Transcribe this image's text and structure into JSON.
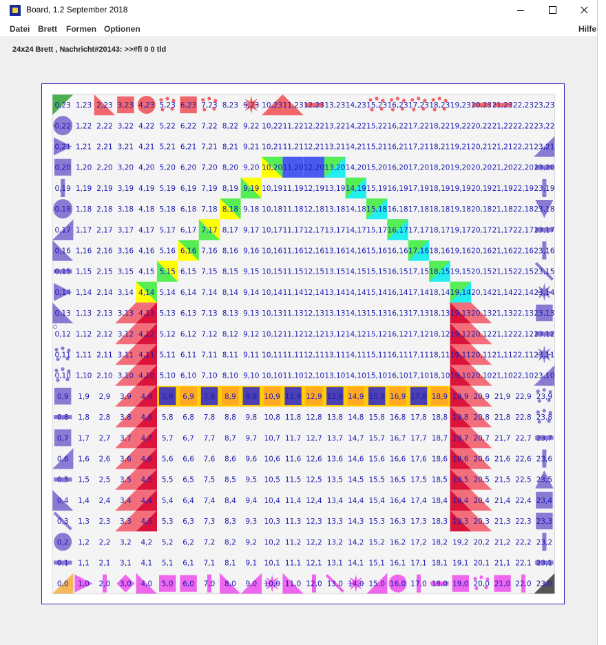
{
  "window": {
    "title": "Board, 1.2 September 2018"
  },
  "menu": {
    "datei": "Datei",
    "brett": "Brett",
    "formen": "Formen",
    "optionen": "Optionen",
    "hilfe": "Hilfe"
  },
  "status_text": "24x24 Brett , Nachricht#20143: >>#fi 0 0 tld",
  "board": {
    "size": 24,
    "label_color": "#1a1ab4",
    "cell_background": "#f4f4f4"
  },
  "colors": {
    "red": "#f0666a",
    "crimson": "#dc143c",
    "pink_tri": "#f26e7a",
    "violet": "#8a7ad2",
    "magenta": "#ee66ee",
    "yellow": "#ffff00",
    "green": "#55ee55",
    "cyan": "#22eeee",
    "blue": "#4a5cf0",
    "orange": "#ffaa22",
    "gold": "#ffcc00",
    "dark_violet": "#4a3fb5",
    "dark_green": "#4caf50",
    "gray": "#555555",
    "tan": "#f4b85a"
  },
  "icons": {
    "app": "board-app-icon",
    "minimize": "minimize-icon",
    "maximize": "maximize-icon",
    "close": "close-icon"
  }
}
